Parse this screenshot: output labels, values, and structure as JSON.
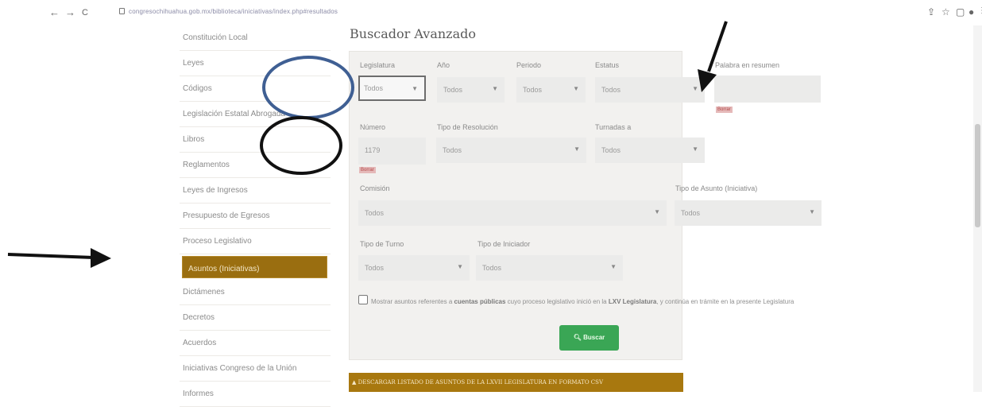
{
  "browser": {
    "back": "←",
    "forward": "→",
    "reload": "C",
    "url": "congresochihuahua.gob.mx/biblioteca/iniciativas/index.php#resultados"
  },
  "sidebar": {
    "items": [
      {
        "label": "Constitución Local"
      },
      {
        "label": "Leyes"
      },
      {
        "label": "Códigos"
      },
      {
        "label": "Legislación Estatal Abrogada"
      },
      {
        "label": "Libros"
      },
      {
        "label": "Reglamentos"
      },
      {
        "label": "Leyes de Ingresos"
      },
      {
        "label": "Presupuesto de Egresos"
      },
      {
        "label": "Proceso Legislativo"
      },
      {
        "label": "Asuntos (Iniciativas)",
        "active": true
      },
      {
        "label": "Dictámenes"
      },
      {
        "label": "Decretos"
      },
      {
        "label": "Acuerdos"
      },
      {
        "label": "Iniciativas Congreso de la Unión"
      },
      {
        "label": "Informes"
      }
    ]
  },
  "main": {
    "title": "Buscador Avanzado",
    "fields": {
      "legislatura": {
        "label": "Legislatura",
        "value": "Todos"
      },
      "anio": {
        "label": "Año",
        "value": "Todos"
      },
      "periodo": {
        "label": "Periodo",
        "value": "Todos"
      },
      "estatus": {
        "label": "Estatus",
        "value": "Todos"
      },
      "palabra": {
        "label": "Palabra en resumen",
        "value": ""
      },
      "numero": {
        "label": "Número",
        "value": "1179"
      },
      "tipo_resolucion": {
        "label": "Tipo de Resolución",
        "value": "Todos"
      },
      "turnadas": {
        "label": "Turnadas a",
        "value": "Todos"
      },
      "comision": {
        "label": "Comisión",
        "value": "Todos"
      },
      "tipo_asunto": {
        "label": "Tipo de Asunto (Iniciativa)",
        "value": "Todos"
      },
      "tipo_turno": {
        "label": "Tipo de Turno",
        "value": "Todos"
      },
      "tipo_iniciador": {
        "label": "Tipo de Iniciador",
        "value": "Todos"
      }
    },
    "badge_text": "Borrar",
    "checkbox": {
      "text_before": "Mostrar asuntos referentes a",
      "bold1": "cuentas públicas",
      "text_middle": "cuyo proceso legislativo inició en la",
      "bold2": "LXV Legislatura",
      "text_after": ", y continúa en trámite en la presente Legislatura"
    },
    "search_button": "Buscar",
    "download_button": "DESCARGAR LISTADO DE ASUNTOS DE LA LXVII LEGISLATURA EN FORMATO CSV"
  },
  "annotations": {
    "blue_circle_color": "#3f5f93",
    "black_circle_color": "#111111",
    "arrow_color": "#111111"
  }
}
